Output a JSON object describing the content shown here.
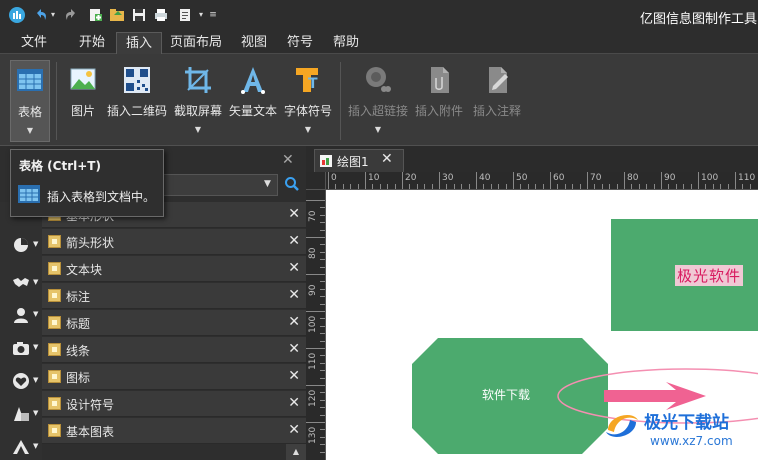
{
  "window": {
    "title": "亿图信息图制作工具(试"
  },
  "quick_access": [
    "app-logo-icon",
    "undo-icon",
    "dropdown-icon",
    "redo-icon",
    "new-icon",
    "open-icon",
    "save-icon",
    "print-icon",
    "export-icon",
    "customize-icon"
  ],
  "ribbon_tabs": [
    "文件",
    "开始",
    "插入",
    "页面布局",
    "视图",
    "符号",
    "帮助"
  ],
  "active_tab": "插入",
  "ribbon": {
    "table": {
      "label": "表格",
      "icon": "table-icon"
    },
    "picture": {
      "label": "图片",
      "icon": "image-icon"
    },
    "qrcode": {
      "label": "插入二维码",
      "icon": "qrcode-icon"
    },
    "screenshot": {
      "label": "截取屏幕",
      "icon": "crop-icon"
    },
    "vector_text": {
      "label": "矢量文本",
      "icon": "vector-text-icon"
    },
    "font_symbol": {
      "label": "字体符号",
      "icon": "font-symbol-icon"
    },
    "hyperlink": {
      "label": "插入超链接",
      "icon": "link-icon"
    },
    "attachment": {
      "label": "插入附件",
      "icon": "attachment-icon"
    },
    "note": {
      "label": "插入注释",
      "icon": "note-icon"
    }
  },
  "tooltip": {
    "title": "表格 (Ctrl+T)",
    "description": "插入表格到文档中。"
  },
  "library": {
    "items": [
      "基本形状",
      "箭头形状",
      "文本块",
      "标注",
      "标题",
      "线条",
      "图标",
      "设计符号",
      "基本图表"
    ],
    "side_icons": [
      "pie-chart-icon",
      "map-icon",
      "user-icon",
      "camera-icon",
      "heart-icon",
      "shapes-icon",
      "triangle-icon"
    ]
  },
  "document": {
    "tab_name": "绘图1",
    "ruler_h": [
      "0",
      "10",
      "20",
      "30",
      "40",
      "50",
      "60",
      "70",
      "80",
      "90",
      "100",
      "110"
    ],
    "ruler_v": [
      "70",
      "80",
      "90",
      "100",
      "110",
      "120",
      "130"
    ],
    "shapes": {
      "rect_text": "极光软件",
      "octagon_text": "软件下载"
    }
  },
  "watermark": {
    "line1": "极光下载站",
    "line2": "www.xz7.com"
  },
  "colors": {
    "shape_green": "#4caa6e",
    "arrow_pink": "#f06292",
    "watermark_blue": "#1e6fd9"
  }
}
